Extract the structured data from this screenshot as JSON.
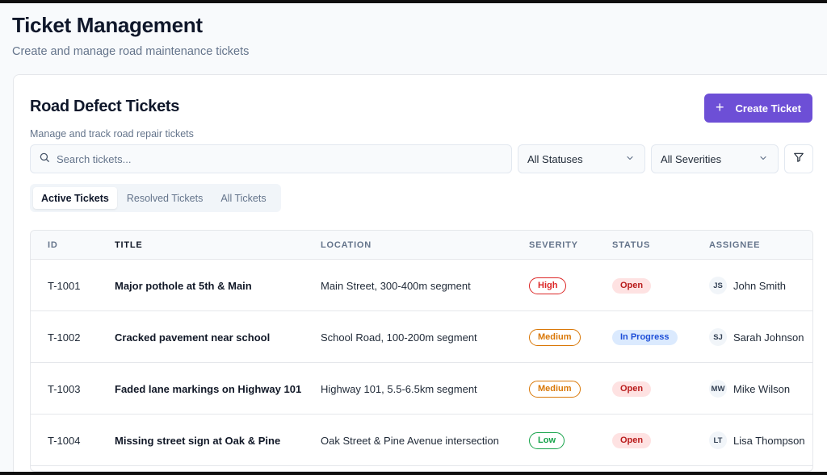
{
  "page": {
    "title": "Ticket Management",
    "subtitle": "Create and manage road maintenance tickets"
  },
  "card": {
    "title": "Road Defect Tickets",
    "subtitle": "Manage and track road repair tickets",
    "create_button": {
      "icon": "plus-icon",
      "label": "Create Ticket"
    }
  },
  "filters": {
    "search_placeholder": "Search tickets...",
    "status_select": "All Statuses",
    "severity_select": "All Severities"
  },
  "tabs": [
    {
      "label": "Active Tickets",
      "active": true
    },
    {
      "label": "Resolved Tickets",
      "active": false
    },
    {
      "label": "All Tickets",
      "active": false
    }
  ],
  "table": {
    "columns": [
      "ID",
      "TITLE",
      "LOCATION",
      "SEVERITY",
      "STATUS",
      "ASSIGNEE"
    ],
    "rows": [
      {
        "id": "T-1001",
        "title": "Major pothole at 5th & Main",
        "location": "Main Street, 300-400m segment",
        "severity": "High",
        "severity_level": "high",
        "status": "Open",
        "status_key": "open",
        "assignee_initials": "JS",
        "assignee": "John Smith"
      },
      {
        "id": "T-1002",
        "title": "Cracked pavement near school",
        "location": "School Road, 100-200m segment",
        "severity": "Medium",
        "severity_level": "medium",
        "status": "In Progress",
        "status_key": "progress",
        "assignee_initials": "SJ",
        "assignee": "Sarah Johnson"
      },
      {
        "id": "T-1003",
        "title": "Faded lane markings on Highway 101",
        "location": "Highway 101, 5.5-6.5km segment",
        "severity": "Medium",
        "severity_level": "medium",
        "status": "Open",
        "status_key": "open",
        "assignee_initials": "MW",
        "assignee": "Mike Wilson"
      },
      {
        "id": "T-1004",
        "title": "Missing street sign at Oak & Pine",
        "location": "Oak Street & Pine Avenue intersection",
        "severity": "Low",
        "severity_level": "low",
        "status": "Open",
        "status_key": "open",
        "assignee_initials": "LT",
        "assignee": "Lisa Thompson"
      }
    ]
  },
  "colors": {
    "accent": "#6d4fd6",
    "severity_high": "#dc2626",
    "severity_medium": "#d97706",
    "severity_low": "#16a34a",
    "status_open_bg": "#fee2e2",
    "status_progress_bg": "#dbeafe"
  }
}
